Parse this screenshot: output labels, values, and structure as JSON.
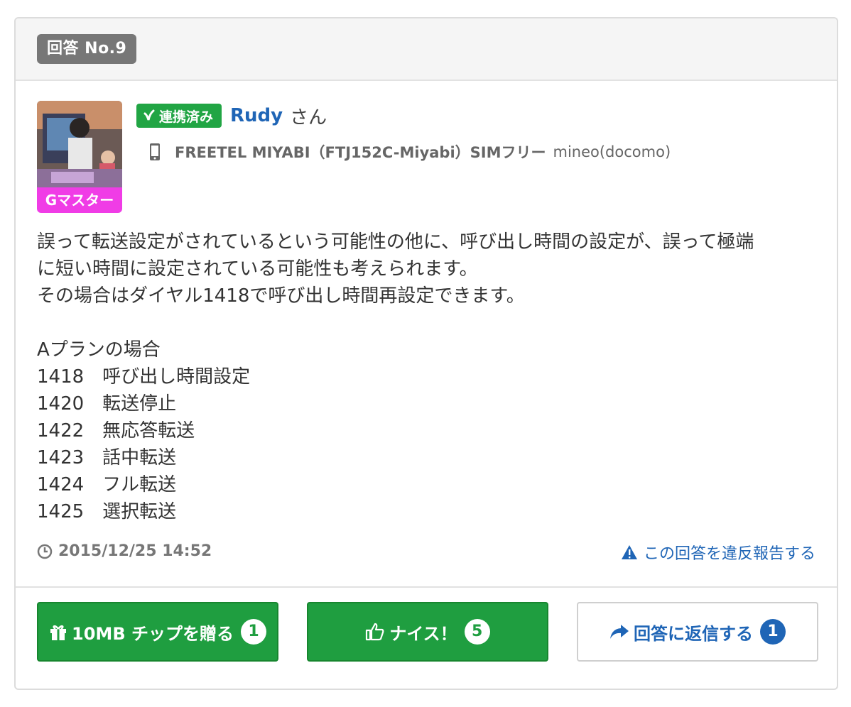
{
  "header": {
    "answer_number": "回答 No.9"
  },
  "user": {
    "avatar_badge": "Gマスター",
    "linked_label": "連携済み",
    "name": "Rudy",
    "honorific": "さん",
    "device": "FREETEL MIYABI（FTJ152C-Miyabi）SIMフリー",
    "carrier": "mineo(docomo)"
  },
  "body": {
    "lines": [
      "誤って転送設定がされているという可能性の他に、呼び出し時間の設定が、誤って極端",
      "に短い時間に設定されている可能性も考えられます。",
      "その場合はダイヤル1418で呼び出し時間再設定できます。",
      "",
      "Aプランの場合",
      "1418　呼び出し時間設定",
      "1420　転送停止",
      "1422　無応答転送",
      "1423　話中転送",
      "1424　フル転送",
      "1425　選択転送"
    ]
  },
  "meta": {
    "datetime": "2015/12/25 14:52",
    "report_label": "この回答を違反報告する"
  },
  "actions": {
    "tip_label": "10MB チップを贈る",
    "tip_count": "1",
    "nice_label": "ナイス！",
    "nice_count": "5",
    "reply_label": "回答に返信する",
    "reply_count": "1"
  },
  "colors": {
    "green": "#1f9e40",
    "blue": "#1f65b6",
    "badge_pink": "#f03ce6",
    "header_gray": "#777777"
  }
}
